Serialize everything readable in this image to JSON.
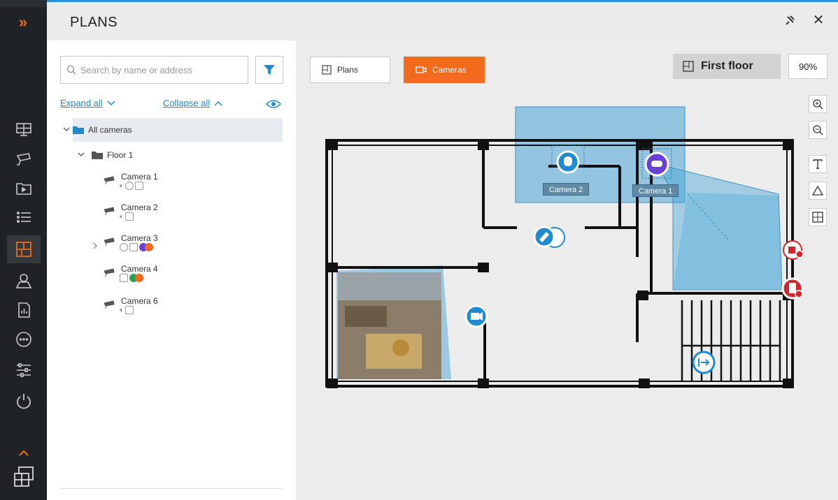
{
  "header": {
    "title": "PLANS"
  },
  "search": {
    "placeholder": "Search by name or address"
  },
  "tree_controls": {
    "expand_all": "Expand all",
    "collapse_all": "Collapse all"
  },
  "tree": {
    "root": "All cameras",
    "floor": "Floor 1",
    "cameras": [
      {
        "name": "Camera 1"
      },
      {
        "name": "Camera 2"
      },
      {
        "name": "Camera 3"
      },
      {
        "name": "Camera 4"
      },
      {
        "name": "Camera 6"
      }
    ]
  },
  "toolbar": {
    "plans_label": "Plans",
    "cameras_label": "Cameras",
    "floor_label": "First floor",
    "zoom": "90%"
  },
  "map_labels": {
    "camera2": "Camera 2",
    "camera1": "Camera 1"
  },
  "colors": {
    "accent": "#f26a1b",
    "link": "#1f8ad0",
    "rail": "#1f2326",
    "fov": "#4aa6d8",
    "alarm": "#d0282e",
    "ptz": "#6a3fd6"
  }
}
